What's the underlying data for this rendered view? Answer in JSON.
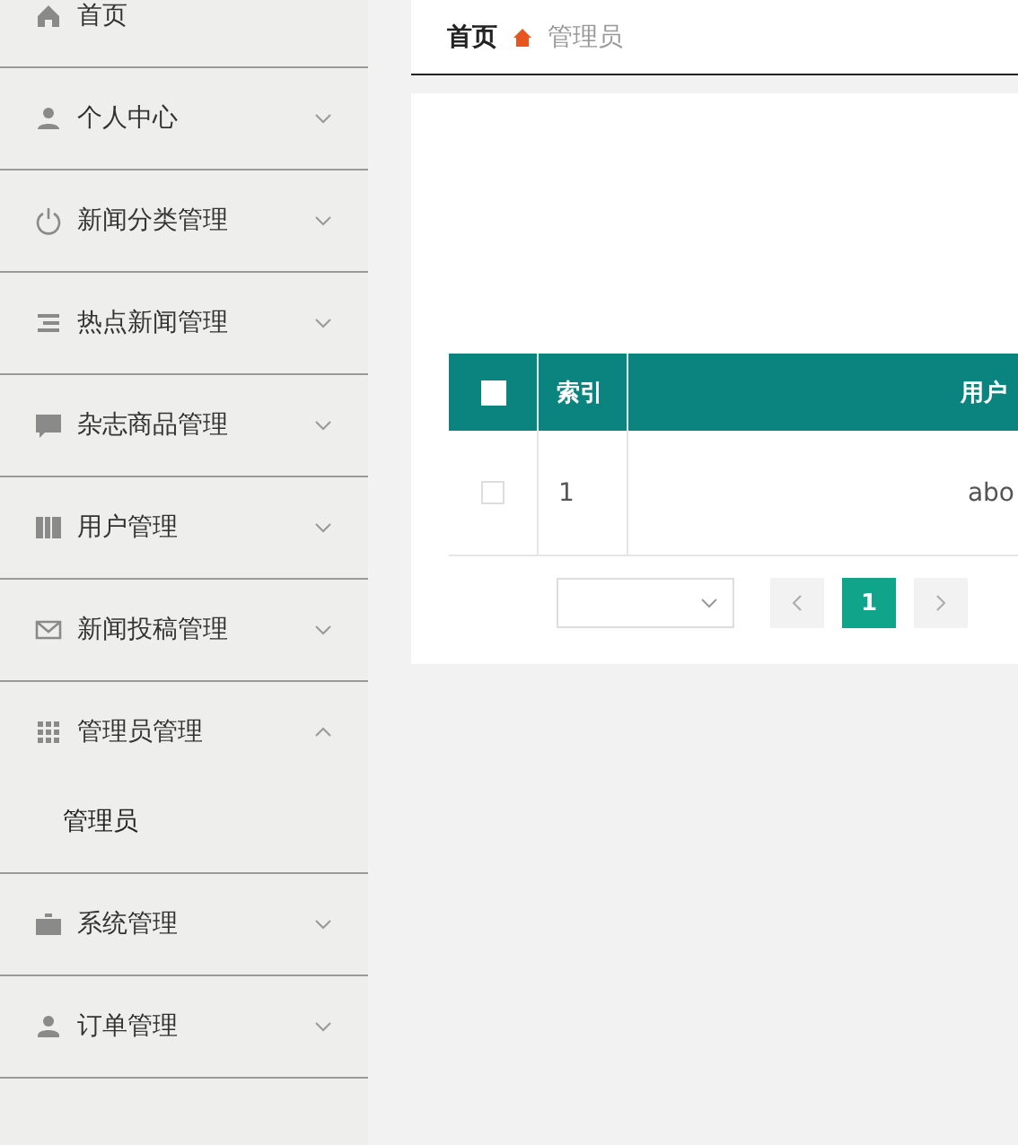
{
  "sidebar": {
    "items": [
      {
        "label": "首页",
        "kind": "link"
      },
      {
        "label": "个人中心",
        "kind": "menu",
        "expanded": false
      },
      {
        "label": "新闻分类管理",
        "kind": "menu",
        "expanded": false
      },
      {
        "label": "热点新闻管理",
        "kind": "menu",
        "expanded": false
      },
      {
        "label": "杂志商品管理",
        "kind": "menu",
        "expanded": false
      },
      {
        "label": "用户管理",
        "kind": "menu",
        "expanded": false
      },
      {
        "label": "新闻投稿管理",
        "kind": "menu",
        "expanded": false
      },
      {
        "label": "管理员管理",
        "kind": "menu",
        "expanded": true,
        "children": [
          {
            "label": "管理员"
          }
        ]
      },
      {
        "label": "系统管理",
        "kind": "menu",
        "expanded": false
      },
      {
        "label": "订单管理",
        "kind": "menu",
        "expanded": false
      }
    ]
  },
  "breadcrumb": [
    "首页",
    "管理员"
  ],
  "table": {
    "header_checked": false,
    "columns": [
      "索引",
      "用户"
    ],
    "rows": [
      {
        "checked": false,
        "cells": [
          "1",
          "abo"
        ]
      }
    ]
  },
  "pagination": {
    "pages": [
      {
        "label": "1",
        "selected": true
      }
    ]
  }
}
